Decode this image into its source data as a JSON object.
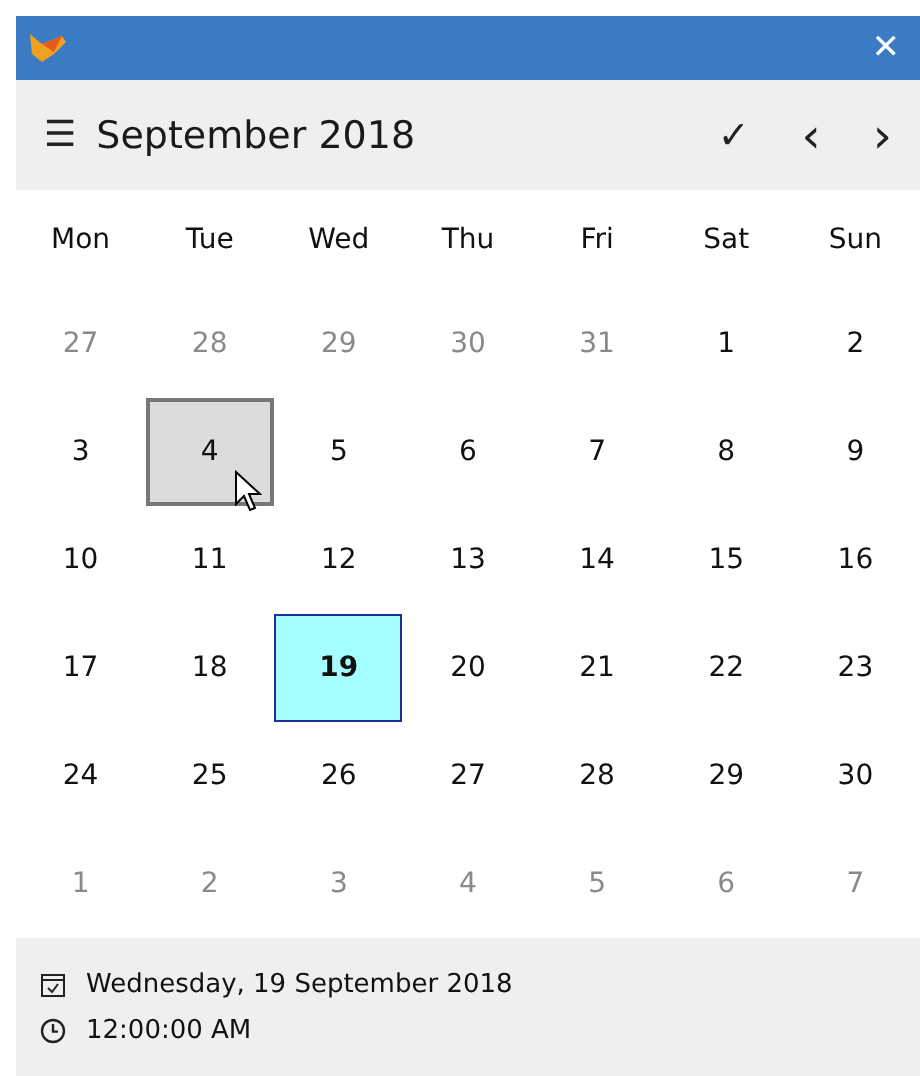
{
  "window": {
    "close": "✕"
  },
  "header": {
    "menu": "☰",
    "title": "September 2018",
    "confirm": "✓",
    "prev": "‹",
    "next": "›"
  },
  "weekdays": [
    "Mon",
    "Tue",
    "Wed",
    "Thu",
    "Fri",
    "Sat",
    "Sun"
  ],
  "days": [
    {
      "label": "27",
      "outside": true,
      "selected": false,
      "hovered": false
    },
    {
      "label": "28",
      "outside": true,
      "selected": false,
      "hovered": false
    },
    {
      "label": "29",
      "outside": true,
      "selected": false,
      "hovered": false
    },
    {
      "label": "30",
      "outside": true,
      "selected": false,
      "hovered": false
    },
    {
      "label": "31",
      "outside": true,
      "selected": false,
      "hovered": false
    },
    {
      "label": "1",
      "outside": false,
      "selected": false,
      "hovered": false
    },
    {
      "label": "2",
      "outside": false,
      "selected": false,
      "hovered": false
    },
    {
      "label": "3",
      "outside": false,
      "selected": false,
      "hovered": false
    },
    {
      "label": "4",
      "outside": false,
      "selected": false,
      "hovered": true
    },
    {
      "label": "5",
      "outside": false,
      "selected": false,
      "hovered": false
    },
    {
      "label": "6",
      "outside": false,
      "selected": false,
      "hovered": false
    },
    {
      "label": "7",
      "outside": false,
      "selected": false,
      "hovered": false
    },
    {
      "label": "8",
      "outside": false,
      "selected": false,
      "hovered": false
    },
    {
      "label": "9",
      "outside": false,
      "selected": false,
      "hovered": false
    },
    {
      "label": "10",
      "outside": false,
      "selected": false,
      "hovered": false
    },
    {
      "label": "11",
      "outside": false,
      "selected": false,
      "hovered": false
    },
    {
      "label": "12",
      "outside": false,
      "selected": false,
      "hovered": false
    },
    {
      "label": "13",
      "outside": false,
      "selected": false,
      "hovered": false
    },
    {
      "label": "14",
      "outside": false,
      "selected": false,
      "hovered": false
    },
    {
      "label": "15",
      "outside": false,
      "selected": false,
      "hovered": false
    },
    {
      "label": "16",
      "outside": false,
      "selected": false,
      "hovered": false
    },
    {
      "label": "17",
      "outside": false,
      "selected": false,
      "hovered": false
    },
    {
      "label": "18",
      "outside": false,
      "selected": false,
      "hovered": false
    },
    {
      "label": "19",
      "outside": false,
      "selected": true,
      "hovered": false
    },
    {
      "label": "20",
      "outside": false,
      "selected": false,
      "hovered": false
    },
    {
      "label": "21",
      "outside": false,
      "selected": false,
      "hovered": false
    },
    {
      "label": "22",
      "outside": false,
      "selected": false,
      "hovered": false
    },
    {
      "label": "23",
      "outside": false,
      "selected": false,
      "hovered": false
    },
    {
      "label": "24",
      "outside": false,
      "selected": false,
      "hovered": false
    },
    {
      "label": "25",
      "outside": false,
      "selected": false,
      "hovered": false
    },
    {
      "label": "26",
      "outside": false,
      "selected": false,
      "hovered": false
    },
    {
      "label": "27",
      "outside": false,
      "selected": false,
      "hovered": false
    },
    {
      "label": "28",
      "outside": false,
      "selected": false,
      "hovered": false
    },
    {
      "label": "29",
      "outside": false,
      "selected": false,
      "hovered": false
    },
    {
      "label": "30",
      "outside": false,
      "selected": false,
      "hovered": false
    },
    {
      "label": "1",
      "outside": true,
      "selected": false,
      "hovered": false
    },
    {
      "label": "2",
      "outside": true,
      "selected": false,
      "hovered": false
    },
    {
      "label": "3",
      "outside": true,
      "selected": false,
      "hovered": false
    },
    {
      "label": "4",
      "outside": true,
      "selected": false,
      "hovered": false
    },
    {
      "label": "5",
      "outside": true,
      "selected": false,
      "hovered": false
    },
    {
      "label": "6",
      "outside": true,
      "selected": false,
      "hovered": false
    },
    {
      "label": "7",
      "outside": true,
      "selected": false,
      "hovered": false
    }
  ],
  "footer": {
    "date": "Wednesday, 19 September 2018",
    "time": "12:00:00 AM"
  }
}
